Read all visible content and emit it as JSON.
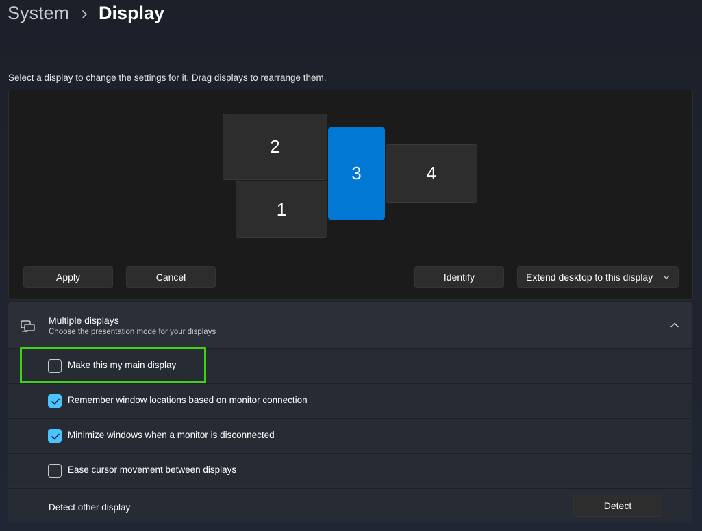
{
  "breadcrumb": {
    "parent": "System",
    "current": "Display"
  },
  "instruction": "Select a display to change the settings for it. Drag displays to rearrange them.",
  "arrangement": {
    "monitors": [
      {
        "id": "2",
        "selected": false
      },
      {
        "id": "1",
        "selected": false
      },
      {
        "id": "3",
        "selected": true
      },
      {
        "id": "4",
        "selected": false
      }
    ],
    "apply_label": "Apply",
    "cancel_label": "Cancel",
    "identify_label": "Identify",
    "mode_select": {
      "selected": "Extend desktop to this display",
      "icon": "chevron-down-icon"
    }
  },
  "multiple_displays": {
    "icon": "multiple-displays-icon",
    "title": "Multiple displays",
    "subtitle": "Choose the presentation mode for your displays",
    "collapse_icon": "chevron-up-icon",
    "options": [
      {
        "label": "Make this my main display",
        "checked": false
      },
      {
        "label": "Remember window locations based on monitor connection",
        "checked": true
      },
      {
        "label": "Minimize windows when a monitor is disconnected",
        "checked": true
      },
      {
        "label": "Ease cursor movement between displays",
        "checked": false
      }
    ],
    "detect_label": "Detect other display",
    "detect_button": "Detect"
  },
  "colors": {
    "accent": "#0078d4",
    "checkbox_checked": "#4cc2ff",
    "highlight": "#3fd40f"
  }
}
